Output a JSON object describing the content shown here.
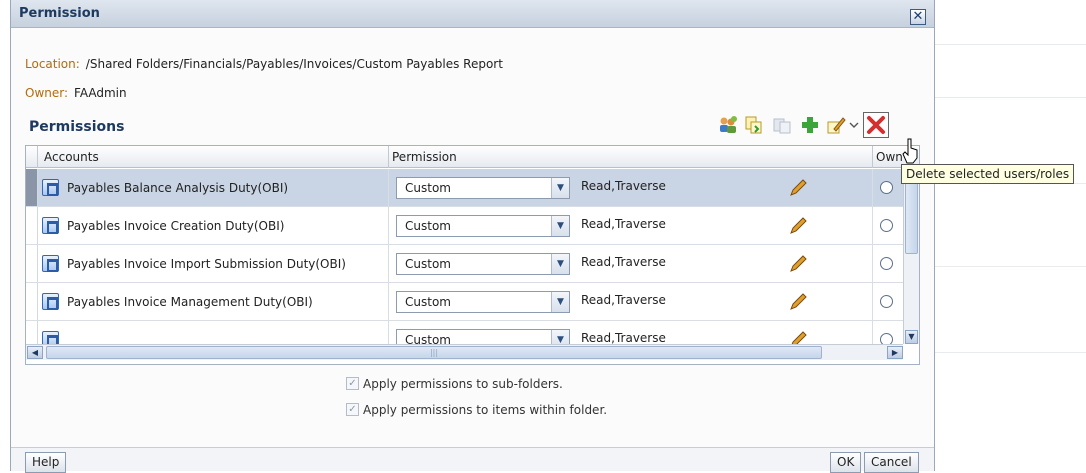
{
  "dialog": {
    "title": "Permission",
    "close_glyph": "✕"
  },
  "location": {
    "label": "Location:",
    "value": "/Shared Folders/Financials/Payables/Invoices/Custom Payables Report"
  },
  "owner": {
    "label": "Owner:",
    "value": "FAAdmin"
  },
  "permissions": {
    "title": "Permissions",
    "toolbar": [
      "add-users-icon",
      "copy-icon",
      "paste-icon",
      "add-icon",
      "edit-icon",
      "dropdown-chevron-icon",
      "delete-icon"
    ],
    "columns": {
      "accounts": "Accounts",
      "permission": "Permission",
      "owner": "Own"
    },
    "rows": [
      {
        "account": "Payables Balance Analysis Duty(OBI)",
        "permission": "Custom",
        "detail": "Read,Traverse",
        "selected": true
      },
      {
        "account": "Payables Invoice Creation Duty(OBI)",
        "permission": "Custom",
        "detail": "Read,Traverse",
        "selected": false
      },
      {
        "account": "Payables Invoice Import Submission Duty(OBI)",
        "permission": "Custom",
        "detail": "Read,Traverse",
        "selected": false
      },
      {
        "account": "Payables Invoice Management Duty(OBI)",
        "permission": "Custom",
        "detail": "Read,Traverse",
        "selected": false
      },
      {
        "account": "",
        "permission": "Custom",
        "detail": "Read,Traverse",
        "selected": false
      }
    ]
  },
  "options": {
    "subfolders": "Apply permissions to sub-folders.",
    "items": "Apply permissions to items within folder."
  },
  "footer": {
    "help": "Help",
    "ok": "OK",
    "cancel": "Cancel"
  },
  "tooltip": "Delete selected users/roles",
  "colors": {
    "title_bar": "#c6d1de",
    "selected_row": "#c9d4e4",
    "label_orange": "#b26b0d",
    "delete_red": "#d32f2f"
  }
}
